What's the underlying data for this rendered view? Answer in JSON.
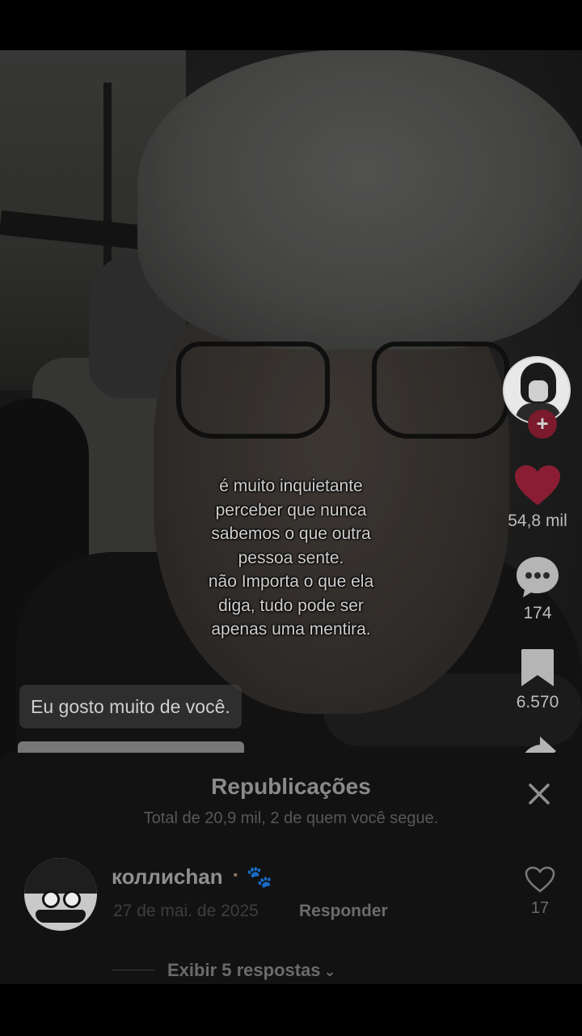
{
  "video": {
    "caption_lines": [
      "é muito inquietante",
      "perceber que nunca",
      "sabemos o que outra",
      "pessoa sente.",
      "não Importa o que ela",
      "diga, tudo pode ser",
      "apenas uma mentira."
    ],
    "comment_bubble": "Eu gosto muito de você."
  },
  "rail": {
    "like_count": "54,8 mil",
    "comment_count": "174",
    "bookmark_count": "6.570",
    "follow_symbol": "+",
    "colors": {
      "like": "#8a1d33",
      "follow": "#7a1a2c"
    },
    "icons": [
      "creator-avatar",
      "heart-icon",
      "comment-icon",
      "bookmark-icon",
      "share-icon"
    ]
  },
  "sheet": {
    "title": "Republicações",
    "subtitle": "Total de 20,9 mil, 2 de quem você segue.",
    "entry": {
      "username": "коллиchan",
      "decoration": "⠂🐾",
      "date": "27 de mai. de 2025",
      "reply_label": "Responder",
      "like_count": "17"
    },
    "view_replies": "Exibir 5 respostas",
    "icons": [
      "close-icon",
      "heart-outline-icon",
      "chevron-down-icon"
    ]
  }
}
